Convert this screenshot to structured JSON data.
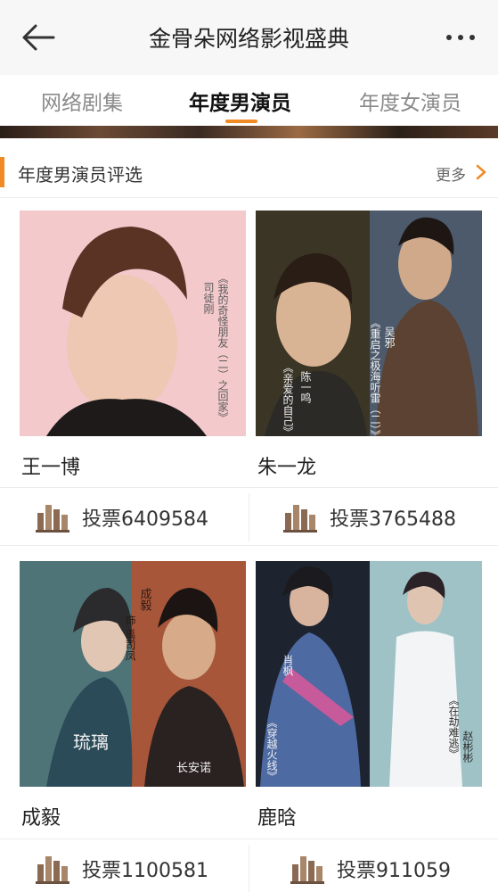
{
  "header": {
    "title": "金骨朵网络影视盛典"
  },
  "tabs": [
    {
      "label": "网络剧集",
      "active": false
    },
    {
      "label": "年度男演员",
      "active": true
    },
    {
      "label": "年度女演员",
      "active": false
    }
  ],
  "section": {
    "title": "年度男演员评选",
    "more_label": "更多"
  },
  "colors": {
    "accent": "#f08a24",
    "vote_icon": "#8a6a52"
  },
  "icons": {
    "back": "arrow-left-icon",
    "menu": "more-dots-icon",
    "chevron": "chevron-right-icon",
    "vote": "bar-chart-icon"
  },
  "cards": [
    {
      "name": "王一博",
      "vote_label": "投票6409584",
      "poster_text": [
        "《我的奇怪朋友（二）之回家》",
        "司徒刚"
      ]
    },
    {
      "name": "朱一龙",
      "vote_label": "投票3765488",
      "poster_text": [
        "陈一鸣",
        "《亲爱的自己》",
        "吴邪",
        "《重启之极海听雷（二）》"
      ]
    },
    {
      "name": "成毅",
      "vote_label": "投票1100581",
      "poster_text": [
        "琉璃",
        "成毅",
        "饰 禹司凤",
        "长安诺"
      ]
    },
    {
      "name": "鹿晗",
      "vote_label": "投票911059",
      "poster_text": [
        "肖枫",
        "《穿越火线》",
        "赵彬彬",
        "《在劫难逃》"
      ]
    }
  ]
}
